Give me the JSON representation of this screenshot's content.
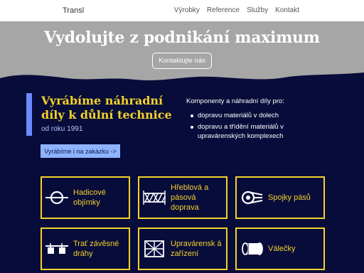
{
  "header": {
    "brand": "Transl",
    "nav": [
      "Výrobky",
      "Reference",
      "Služby",
      "Kontakt"
    ]
  },
  "hero": {
    "title": "Vydolujte z podnikání maximum",
    "cta": "Kontaktujte nás"
  },
  "intro": {
    "title": "Vyrábíme náhradní díly k důlní technice",
    "since": "od roku 1991",
    "custom_button": "Vyrábíme i na zakázku ->"
  },
  "components": {
    "lead": "Komponenty a náhradní díly pro:",
    "items": [
      "dopravu materiálů v dolech",
      "dopravu a třídění materiálů v upravárenských komplexech"
    ]
  },
  "products": [
    {
      "label": "Hadicové objímky",
      "icon": "hose-clamp-icon"
    },
    {
      "label": "Hřeblová a pásová doprava",
      "icon": "conveyor-icon"
    },
    {
      "label": "Spojky pásů",
      "icon": "belt-joint-icon"
    },
    {
      "label": "Trať závěsné dráhy",
      "icon": "suspended-rail-icon"
    },
    {
      "label": "Upravárensk á zařízení",
      "icon": "screen-grid-icon"
    },
    {
      "label": "Válečky",
      "icon": "roller-icon"
    }
  ],
  "colors": {
    "background": "#080c3a",
    "accent_yellow": "#f4d22a",
    "accent_blue": "#6b8bff",
    "hero_gray": "#a6a6a6"
  }
}
